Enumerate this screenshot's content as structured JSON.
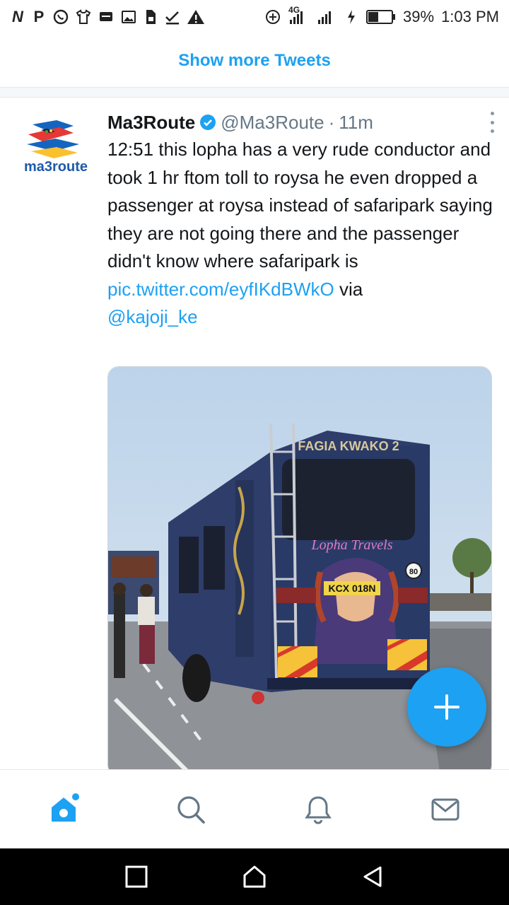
{
  "status_bar": {
    "left_icons": [
      "N",
      "P",
      "whatsapp-icon",
      "shirt-icon",
      "message-icon",
      "image-icon",
      "file-icon",
      "check-icon",
      "warning-icon"
    ],
    "network": "4G",
    "battery": "39%",
    "time": "1:03 PM"
  },
  "timeline": {
    "show_more": "Show more Tweets"
  },
  "tweet": {
    "name": "Ma3Route",
    "handle": "@Ma3Route",
    "separator": "·",
    "time": "11m",
    "text": "12:51 this lopha has a very rude conductor and took 1 hr ftom toll to roysa he even dropped a passenger at roysa instead of safaripark saying they are not going there and the passenger didn't know where safaripark is",
    "link": "pic.twitter.com/eyfIKdBWkO",
    "via": "via",
    "mention": "@kajoji_ke",
    "avatar_text": "ma3route",
    "media": {
      "bus_top_text": "FAGIA KWAKO 2",
      "bus_brand": "Lopha Travels",
      "plate": "KCX 018N",
      "speed_badge": "80"
    }
  },
  "colors": {
    "accent": "#1da1f2",
    "text": "#14171a",
    "muted": "#657786"
  },
  "bottom_nav": [
    "home-icon",
    "search-icon",
    "bell-icon",
    "mail-icon"
  ],
  "android_nav": [
    "recents-icon",
    "home-icon",
    "back-icon"
  ]
}
